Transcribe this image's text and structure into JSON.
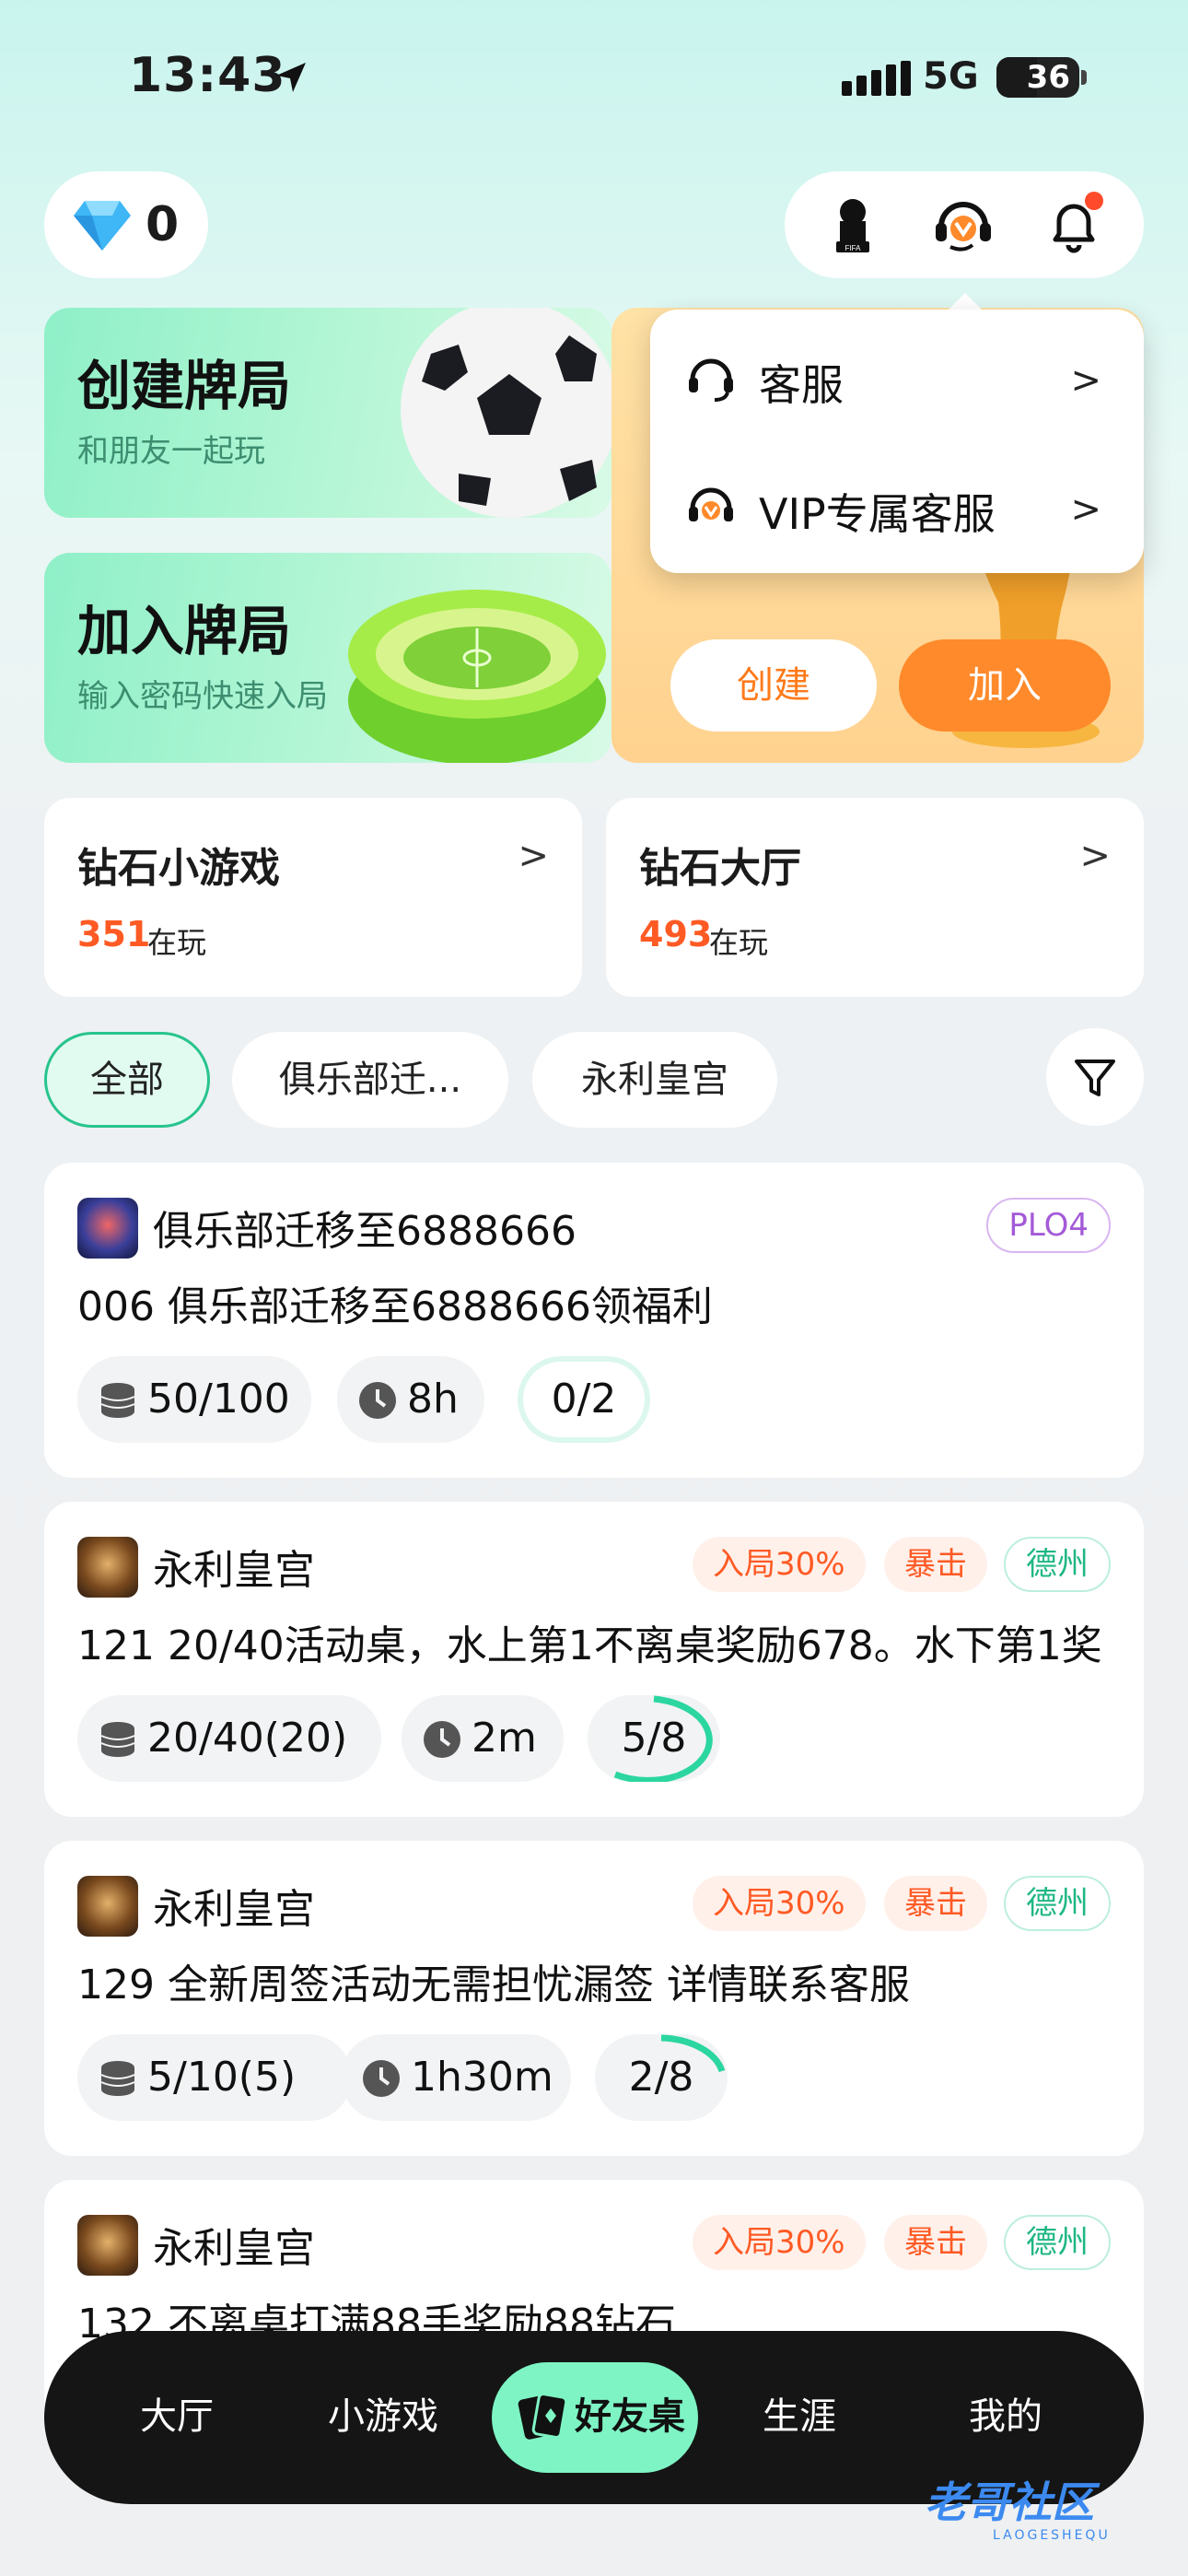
{
  "status_bar": {
    "time": "13:43",
    "network": "5G",
    "battery": "36"
  },
  "top": {
    "diamond_count": "0"
  },
  "cards": {
    "create_title": "创建牌局",
    "create_sub": "和朋友一起玩",
    "join_title": "加入牌局",
    "join_sub": "输入密码快速入局",
    "right_create": "创建",
    "right_join": "加入"
  },
  "popup": [
    {
      "label": "客服"
    },
    {
      "label": "VIP专属客服"
    }
  ],
  "entries": [
    {
      "title": "钻石小游戏",
      "count": "351",
      "suffix": "在玩"
    },
    {
      "title": "钻石大厅",
      "count": "493",
      "suffix": "在玩"
    }
  ],
  "filters": [
    "全部",
    "俱乐部迁...",
    "永利皇宫"
  ],
  "tables": [
    {
      "club": "俱乐部迁移至6888666",
      "tags": [
        "PLO4"
      ],
      "desc": "006 俱乐部迁移至6888666领福利",
      "blinds": "50/100",
      "time": "8h",
      "seats": "0/2"
    },
    {
      "club": "永利皇宫",
      "tags": [
        "入局30%",
        "暴击",
        "德州"
      ],
      "desc": "121 20/40活动桌，水上第1不离桌奖励678。水下第1奖",
      "blinds": "20/40(20)",
      "time": "2m",
      "seats": "5/8"
    },
    {
      "club": "永利皇宫",
      "tags": [
        "入局30%",
        "暴击",
        "德州"
      ],
      "desc": "129 全新周签活动无需担忧漏签 详情联系客服",
      "blinds": "5/10(5)",
      "time": "1h30m",
      "seats": "2/8"
    },
    {
      "club": "永利皇宫",
      "tags": [
        "入局30%",
        "暴击",
        "德州"
      ],
      "desc": "132 不离桌打满88手奖励88钻石"
    }
  ],
  "nav": [
    "大厅",
    "小游戏",
    "好友桌",
    "生涯",
    "我的"
  ],
  "watermark": {
    "main": "老哥社区",
    "sub": "LAOGESHEQU"
  },
  "colors": {
    "accent": "#28c48e",
    "orange": "#ff8a2b",
    "tag_red": "#ff5a24",
    "nav_bg": "#151515"
  }
}
